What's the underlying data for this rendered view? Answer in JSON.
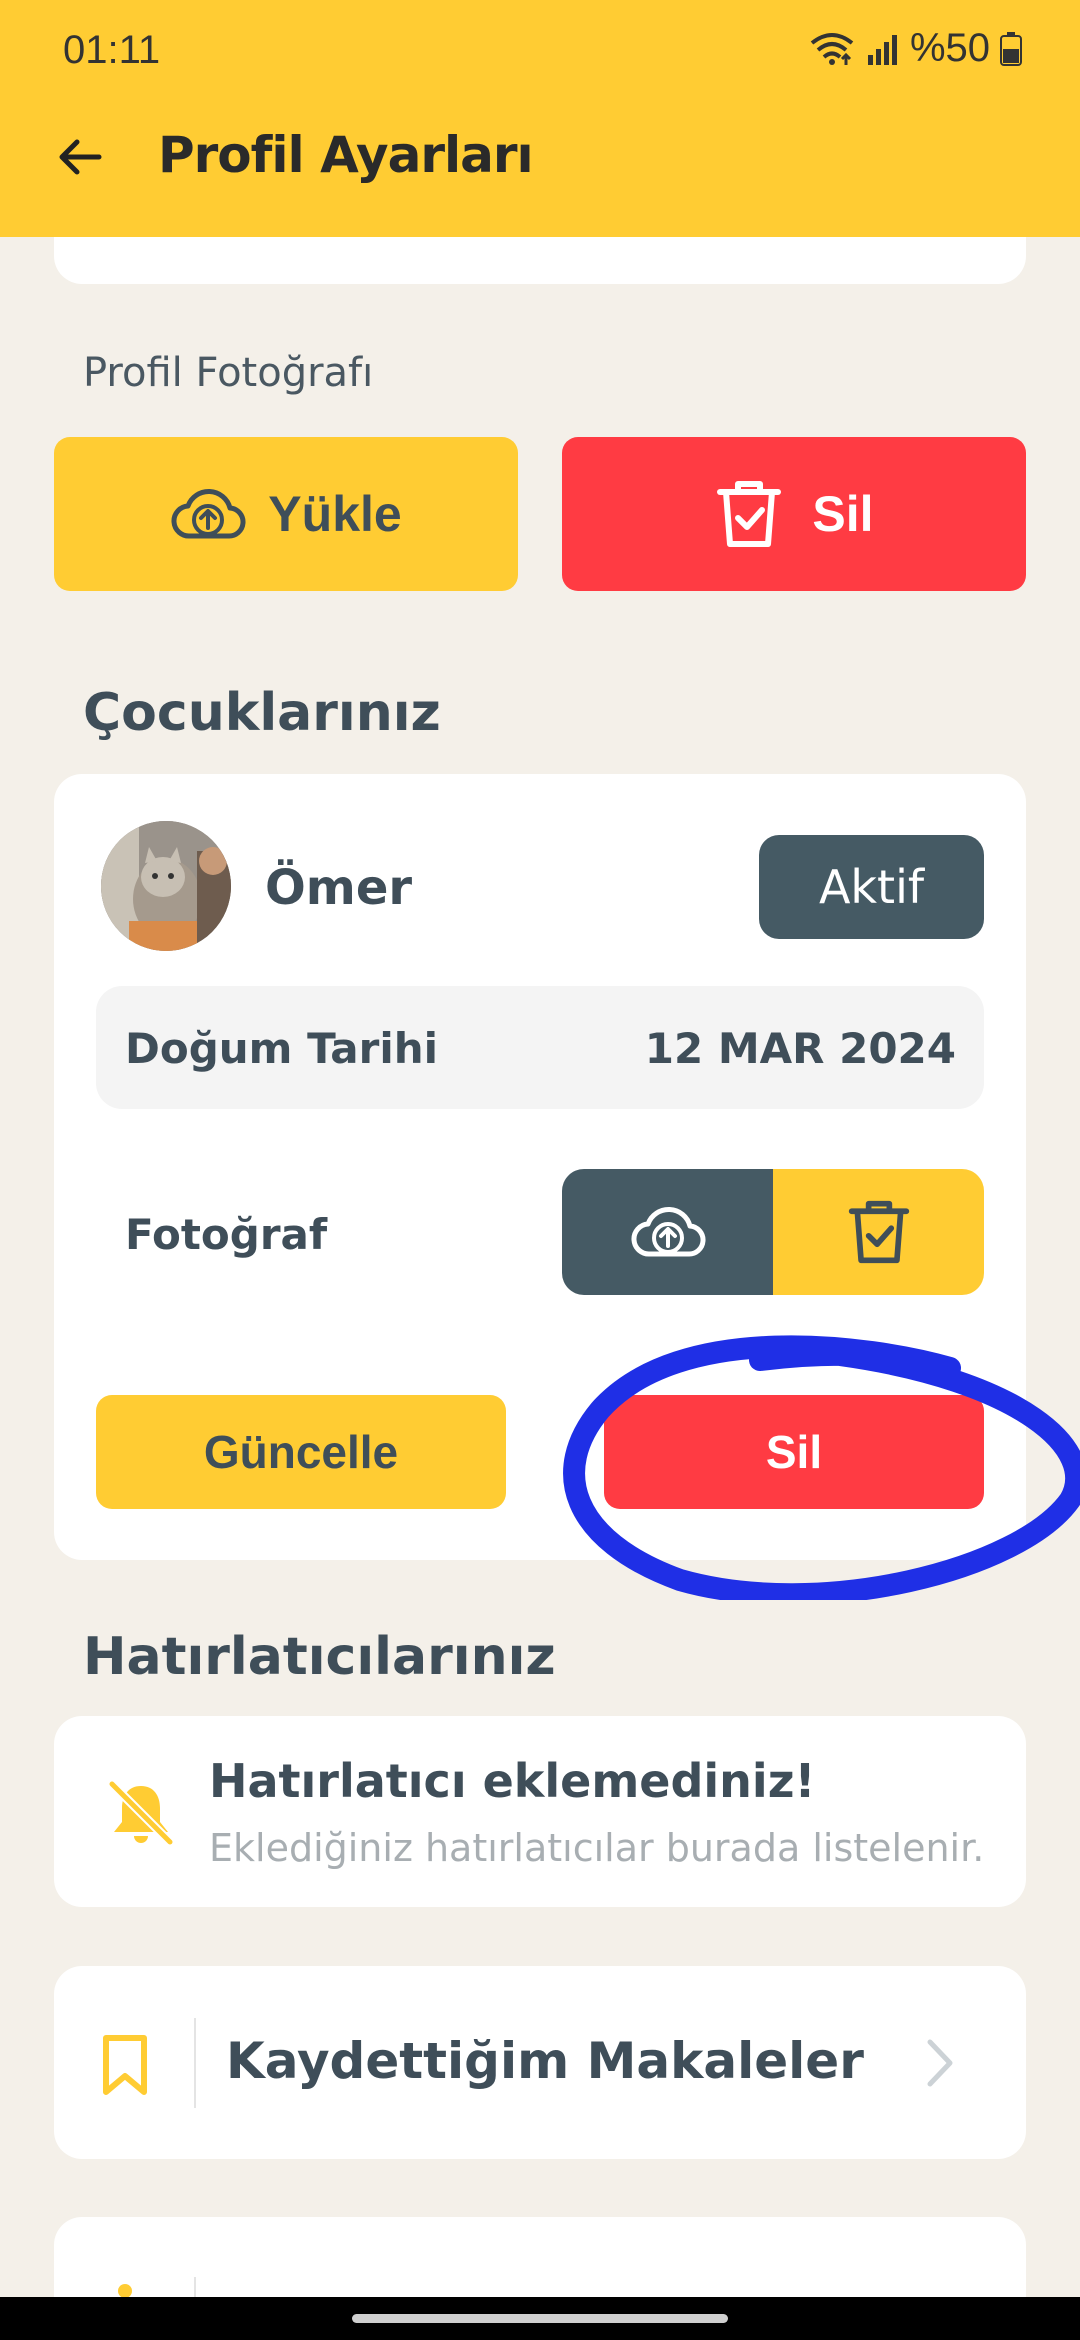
{
  "status_bar": {
    "time": "01:11",
    "battery": "%50"
  },
  "header": {
    "title": "Profil Ayarları"
  },
  "profile_photo": {
    "label": "Profil Fotoğrafı",
    "upload_label": "Yükle",
    "delete_label": "Sil"
  },
  "children": {
    "section_title": "Çocuklarınız",
    "child": {
      "name": "Ömer",
      "status_label": "Aktif",
      "birth_date_label": "Doğum Tarihi",
      "birth_date_value": "12 MAR 2024",
      "photo_label": "Fotoğraf",
      "update_label": "Güncelle",
      "delete_label": "Sil"
    }
  },
  "reminders": {
    "section_title": "Hatırlatıcılarınız",
    "empty_title": "Hatırlatıcı eklemediniz!",
    "empty_subtitle": "Eklediğiniz hatırlatıcılar burada listelenir."
  },
  "saved_articles": {
    "label": "Kaydettiğim Makaleler"
  },
  "colors": {
    "accent_yellow": "#FFCC33",
    "danger_red": "#FF3B43",
    "slate": "#455A64",
    "annotation_blue": "#1F2FE6"
  }
}
